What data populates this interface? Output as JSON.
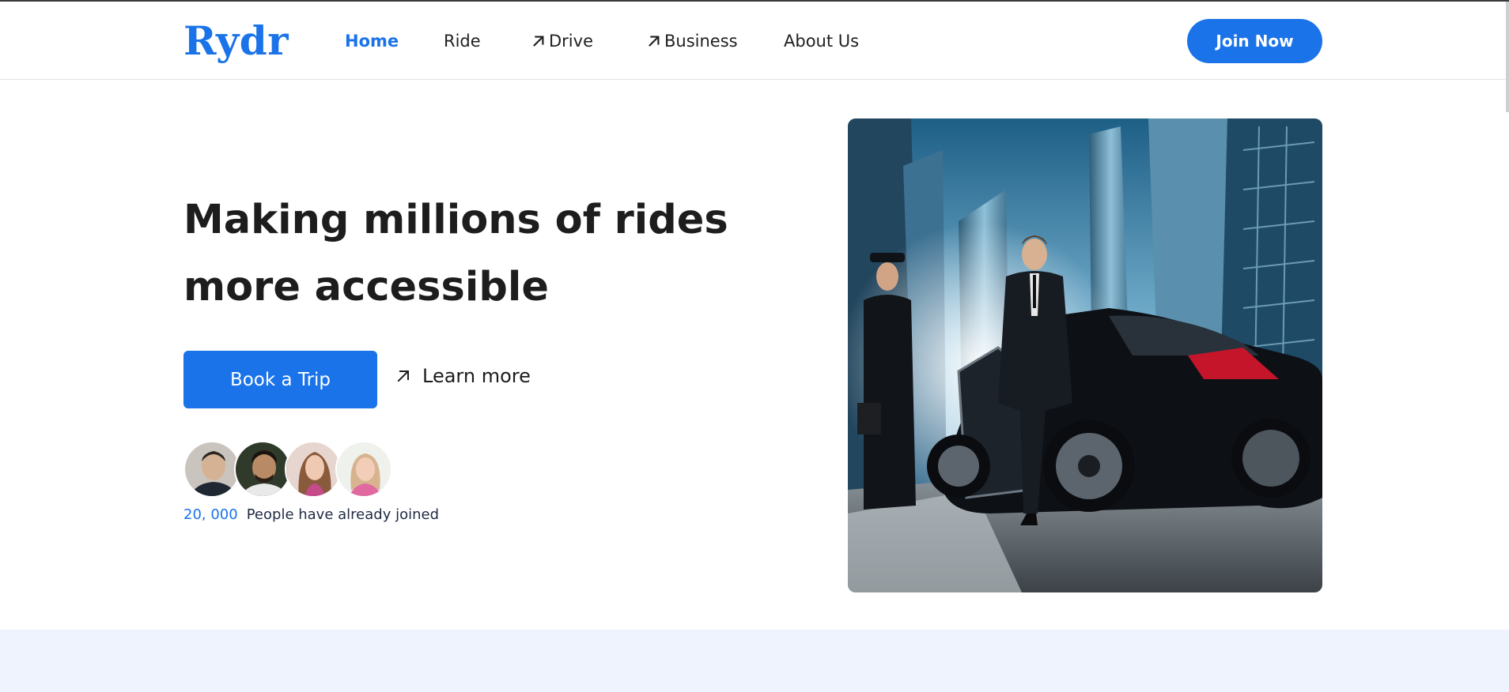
{
  "brand": {
    "logo_text": "Rydr",
    "accent_color": "#1a73e8"
  },
  "nav": {
    "items": [
      {
        "label": "Home",
        "active": true,
        "icon": null
      },
      {
        "label": "Ride",
        "active": false,
        "icon": null
      },
      {
        "label": "Drive",
        "active": false,
        "icon": "arrow-up-right-icon"
      },
      {
        "label": "Business",
        "active": false,
        "icon": "arrow-up-right-icon"
      },
      {
        "label": "About Us",
        "active": false,
        "icon": null
      }
    ],
    "join_label": "Join Now"
  },
  "hero": {
    "title_line1": "Making millions of rides",
    "title_line2": "more accessible",
    "book_label": "Book a Trip",
    "learn_more_label": "Learn more",
    "learn_more_icon": "arrow-up-right-icon",
    "joined_count": "20, 000",
    "joined_label": "People have already joined",
    "image_subject": "chauffeur opening door of black luxury sedan for businessman among skyscrapers"
  },
  "colors": {
    "primary": "#1a73e8",
    "text_dark": "#1d1d1d",
    "lower_band": "#eff3fd"
  }
}
